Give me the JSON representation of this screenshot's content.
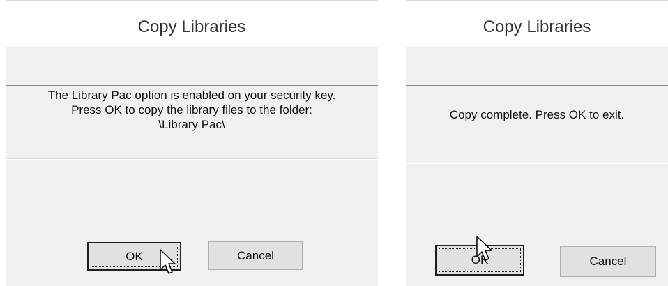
{
  "left_dialog": {
    "title": "Copy Libraries",
    "message_line1": "The Library Pac option is enabled on your security key.",
    "message_line2": "Press OK to copy the library files to the folder:",
    "message_line3": "\\Library Pac\\",
    "ok_label": "OK",
    "cancel_label": "Cancel"
  },
  "right_dialog": {
    "title": "Copy Libraries",
    "message": "Copy complete. Press OK to exit.",
    "ok_label": "OK",
    "cancel_label": "Cancel"
  },
  "colors": {
    "dialog_bg": "#f0f0f0",
    "title_bg": "#ffffff",
    "button_bg": "#e1e1e1",
    "rule": "#8a8a8a"
  },
  "icons": [
    "mouse-pointer-icon"
  ]
}
